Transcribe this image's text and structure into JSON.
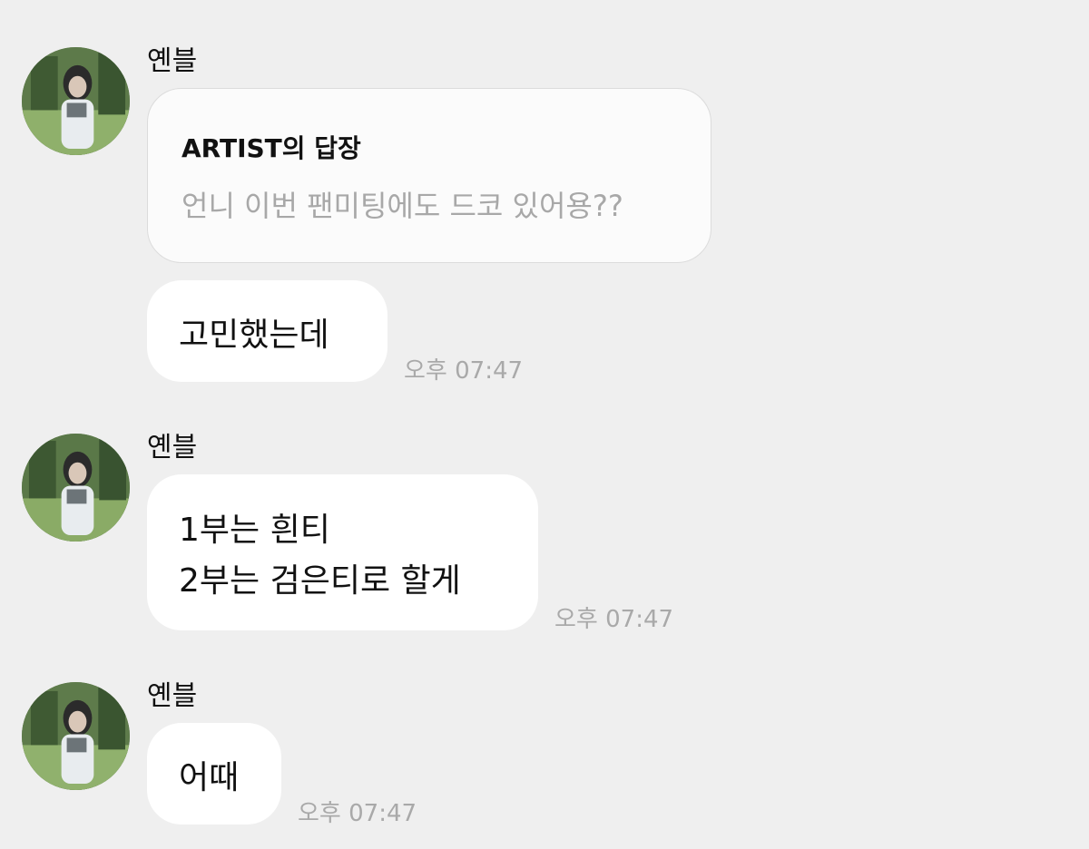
{
  "messages": [
    {
      "sender": "옌블",
      "reply": {
        "title": "ARTIST의 답장",
        "quote": "언니 이번 팬미팅에도 드코 있어용??"
      },
      "text": "고민했는데",
      "time": "오후 07:47"
    },
    {
      "sender": "옌블",
      "lines": [
        "1부는 흰티",
        "2부는 검은티로 할게"
      ],
      "time": "오후 07:47"
    },
    {
      "sender": "옌블",
      "text": "어때",
      "time": "오후 07:47"
    }
  ],
  "colors": {
    "background": "#efefef",
    "bubble": "#ffffff",
    "reply_card": "#fbfbfb",
    "muted_text": "#a9a9a9"
  },
  "icons": {
    "avatar": "profile-photo"
  }
}
